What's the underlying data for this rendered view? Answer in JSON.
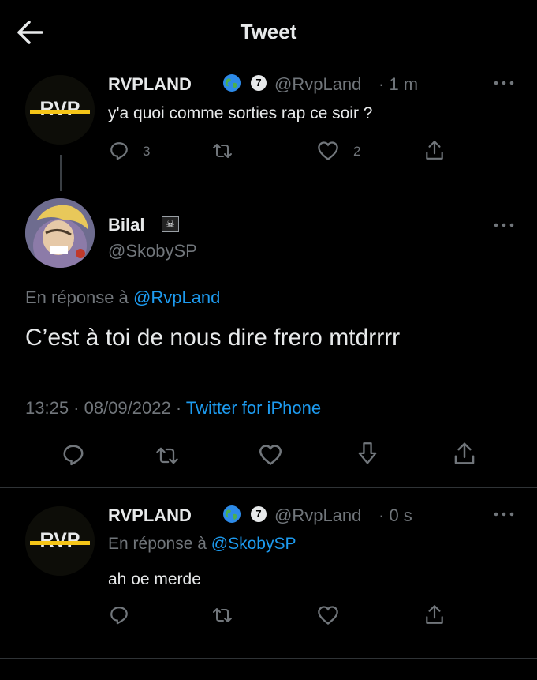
{
  "header": {
    "title": "Tweet"
  },
  "tweet1": {
    "avatar_text": "RVP",
    "name": "RVPLAND",
    "badge": "7",
    "handle": "@RvpLand",
    "time": "· 1 m",
    "text": "y'a quoi comme sorties rap ce soir ?",
    "replies": "3",
    "likes": "2"
  },
  "tweet2": {
    "name": "Bilal",
    "flag": "☠",
    "handle": "@SkobySP",
    "reply_prefix": "En réponse à",
    "reply_to": "@RvpLand",
    "text": "C’est à toi de nous dire frero mtdrrrr",
    "time": "13:25 · 08/09/2022 ·",
    "source": "Twitter for iPhone"
  },
  "tweet3": {
    "avatar_text": "RVP",
    "name": "RVPLAND",
    "badge": "7",
    "handle": "@RvpLand",
    "time": "· 0 s",
    "reply_prefix": "En réponse à",
    "reply_to": "@SkobySP",
    "text": "ah oe merde"
  },
  "colors": {
    "background": "#000000",
    "text": "#e7e9ea",
    "muted": "#71767b",
    "link": "#1d9bf0",
    "logo_gold": "#f5c518"
  }
}
